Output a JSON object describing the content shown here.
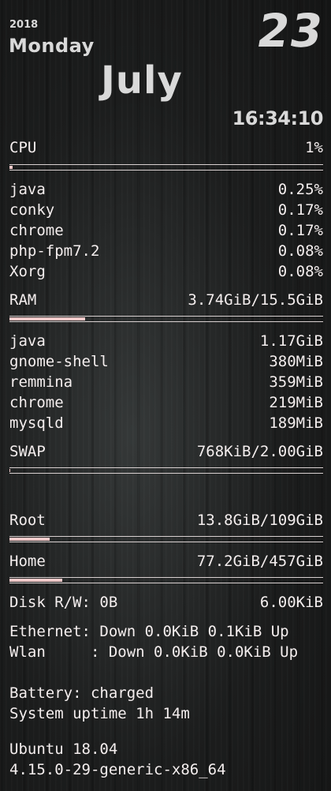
{
  "date": {
    "year": "2018",
    "weekday": "Monday",
    "day": "23",
    "month": "July",
    "time": "16:34:10"
  },
  "cpu": {
    "label": "CPU",
    "value": "1%",
    "usage_fraction": 0.01,
    "processes": [
      {
        "name": "java",
        "value": "0.25%"
      },
      {
        "name": "conky",
        "value": "0.17%"
      },
      {
        "name": "chrome",
        "value": "0.17%"
      },
      {
        "name": "php-fpm7.2",
        "value": "0.08%"
      },
      {
        "name": "Xorg",
        "value": "0.08%"
      }
    ]
  },
  "ram": {
    "label": "RAM",
    "value": "3.74GiB/15.5GiB",
    "usage_fraction": 0.24,
    "processes": [
      {
        "name": "java",
        "value": "1.17GiB"
      },
      {
        "name": "gnome-shell",
        "value": "380MiB"
      },
      {
        "name": "remmina",
        "value": "359MiB"
      },
      {
        "name": "chrome",
        "value": "219MiB"
      },
      {
        "name": "mysqld",
        "value": "189MiB"
      }
    ]
  },
  "swap": {
    "label": "SWAP",
    "value": "768KiB/2.00GiB",
    "usage_fraction": 0.0004
  },
  "root": {
    "label": "Root",
    "value": "13.8GiB/109GiB",
    "usage_fraction": 0.127
  },
  "home": {
    "label": "Home",
    "value": "77.2GiB/457GiB",
    "usage_fraction": 0.169
  },
  "disk": {
    "label": "Disk R/W: 0B",
    "value": "6.00KiB"
  },
  "network": {
    "ethernet": "Ethernet: Down 0.0KiB 0.1KiB Up",
    "wlan": "Wlan     : Down 0.0KiB 0.0KiB Up"
  },
  "system": {
    "battery": "Battery: charged",
    "uptime": "System uptime 1h 14m",
    "os": "Ubuntu 18.04",
    "kernel": "4.15.0-29-generic-x86_64"
  },
  "colors": {
    "text": "#f4eeee",
    "bar_fill": "#f0c9c9",
    "date_text": "#d9d9d9"
  }
}
